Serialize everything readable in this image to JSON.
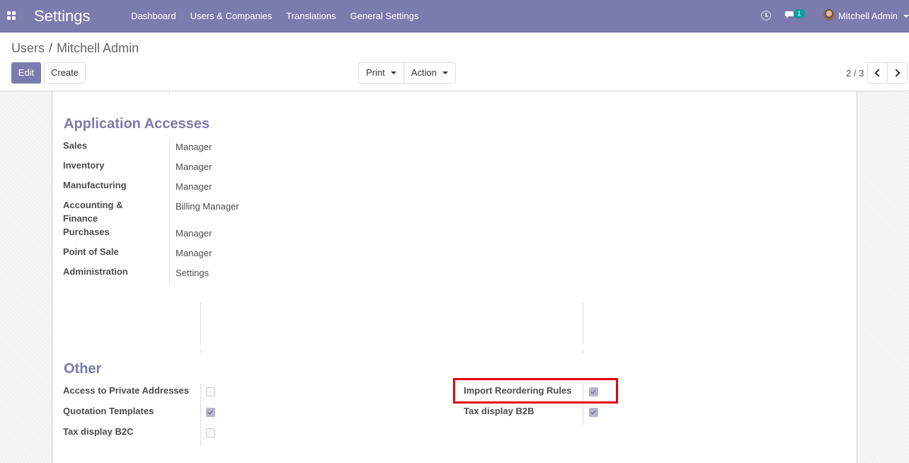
{
  "navbar": {
    "app_title": "Settings",
    "menu": [
      "Dashboard",
      "Users & Companies",
      "Translations",
      "General Settings"
    ],
    "chat_count": "1",
    "user_name": "Mitchell Admin",
    "bg_color": "#7c7bad"
  },
  "control_panel": {
    "breadcrumb_parent": "Users",
    "breadcrumb_separator": "/",
    "breadcrumb_current": "Mitchell Admin",
    "edit_label": "Edit",
    "create_label": "Create",
    "print_label": "Print",
    "action_label": "Action",
    "pager": "2 / 3"
  },
  "application_accesses": {
    "title": "Application Accesses",
    "rows": [
      {
        "label": "Sales",
        "value": "Manager"
      },
      {
        "label": "Inventory",
        "value": "Manager"
      },
      {
        "label": "Manufacturing",
        "value": "Manager"
      },
      {
        "label": "Accounting & Finance",
        "value": "Billing Manager"
      },
      {
        "label": "Purchases",
        "value": "Manager"
      },
      {
        "label": "Point of Sale",
        "value": "Manager"
      },
      {
        "label": "Administration",
        "value": "Settings"
      }
    ]
  },
  "other": {
    "title": "Other",
    "left": [
      {
        "label": "Access to Private Addresses",
        "checked": false
      },
      {
        "label": "Quotation Templates",
        "checked": true
      },
      {
        "label": "Tax display B2C",
        "checked": false
      }
    ],
    "right": [
      {
        "label": "Import Reordering Rules",
        "checked": true
      },
      {
        "label": "Tax display B2B",
        "checked": true
      }
    ]
  },
  "colors": {
    "accent": "#7c7bad",
    "highlight": "#e4000f"
  }
}
